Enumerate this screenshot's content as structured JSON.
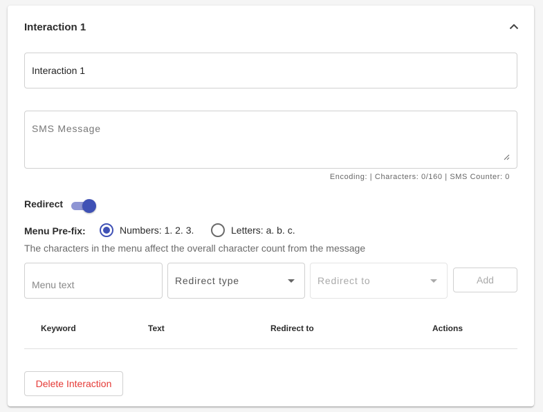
{
  "panel": {
    "title": "Interaction 1"
  },
  "name_field": {
    "value": "Interaction 1"
  },
  "sms_field": {
    "placeholder": "SMS Message",
    "value": ""
  },
  "counter": "Encoding: | Characters: 0/160 | SMS Counter: 0",
  "redirect": {
    "label": "Redirect",
    "enabled": true
  },
  "menu_prefix": {
    "label": "Menu Pre-fix:",
    "options": [
      {
        "label": "Numbers: 1. 2. 3.",
        "selected": true
      },
      {
        "label": "Letters: a. b. c.",
        "selected": false
      }
    ],
    "hint": "The characters in the menu affect the overall character count from the message"
  },
  "menu_row": {
    "menu_text_placeholder": "Menu text",
    "redirect_type_placeholder": "Redirect type",
    "redirect_to_placeholder": "Redirect to",
    "add_label": "Add"
  },
  "table": {
    "headers": [
      "Keyword",
      "Text",
      "Redirect to",
      "Actions"
    ]
  },
  "delete_label": "Delete Interaction",
  "colors": {
    "primary": "#3f51b5",
    "danger": "#e53935"
  },
  "icons": {
    "collapse": "chevron-up-icon",
    "select_caret": "caret-down-icon"
  }
}
